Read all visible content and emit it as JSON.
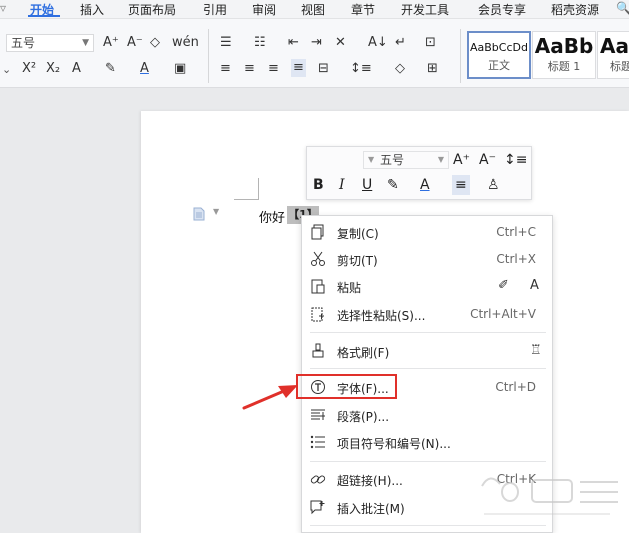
{
  "menu_tabs": [
    {
      "label": "开始",
      "active": true
    },
    {
      "label": "插入"
    },
    {
      "label": "页面布局"
    },
    {
      "label": "引用"
    },
    {
      "label": "审阅"
    },
    {
      "label": "视图"
    },
    {
      "label": "章节"
    },
    {
      "label": "开发工具"
    },
    {
      "label": "会员专享"
    },
    {
      "label": "稻壳资源"
    }
  ],
  "ribbon": {
    "font_size_value": "五号",
    "styles": [
      {
        "sample": "AaBbCcDd",
        "name": "正文"
      },
      {
        "sample": "AaBb",
        "name": "标题 1"
      },
      {
        "sample": "AaB",
        "name": "标题"
      }
    ]
  },
  "document": {
    "text": "你好",
    "field_mark": "【1】"
  },
  "mini_toolbar": {
    "font_size_value": "五号",
    "bold": "B",
    "italic": "I",
    "underline": "U",
    "font_color_letter": "A"
  },
  "context_menu": {
    "items": [
      {
        "label": "复制(C)",
        "shortcut": "Ctrl+C",
        "icon": "copy-icon"
      },
      {
        "label": "剪切(T)",
        "shortcut": "Ctrl+X",
        "icon": "scissors-icon"
      },
      {
        "label": "粘贴",
        "shortcut": "",
        "icon": "paste-icon"
      },
      {
        "label": "选择性粘贴(S)...",
        "shortcut": "Ctrl+Alt+V",
        "icon": "paste-special-icon"
      },
      {
        "label": "格式刷(F)",
        "shortcut": "",
        "icon": "format-painter-icon"
      },
      {
        "label": "字体(F)...",
        "shortcut": "Ctrl+D",
        "icon": "font-icon",
        "highlighted": true
      },
      {
        "label": "段落(P)...",
        "shortcut": "",
        "icon": "paragraph-icon"
      },
      {
        "label": "项目符号和编号(N)...",
        "shortcut": "",
        "icon": "bullets-numbering-icon"
      },
      {
        "label": "超链接(H)...",
        "shortcut": "Ctrl+K",
        "icon": "hyperlink-icon"
      },
      {
        "label": "插入批注(M)",
        "shortcut": "",
        "icon": "insert-comment-icon"
      }
    ]
  },
  "colors": {
    "accent": "#2f6fe0",
    "highlight_box": "#e0302a",
    "arrow": "#e0302a"
  }
}
